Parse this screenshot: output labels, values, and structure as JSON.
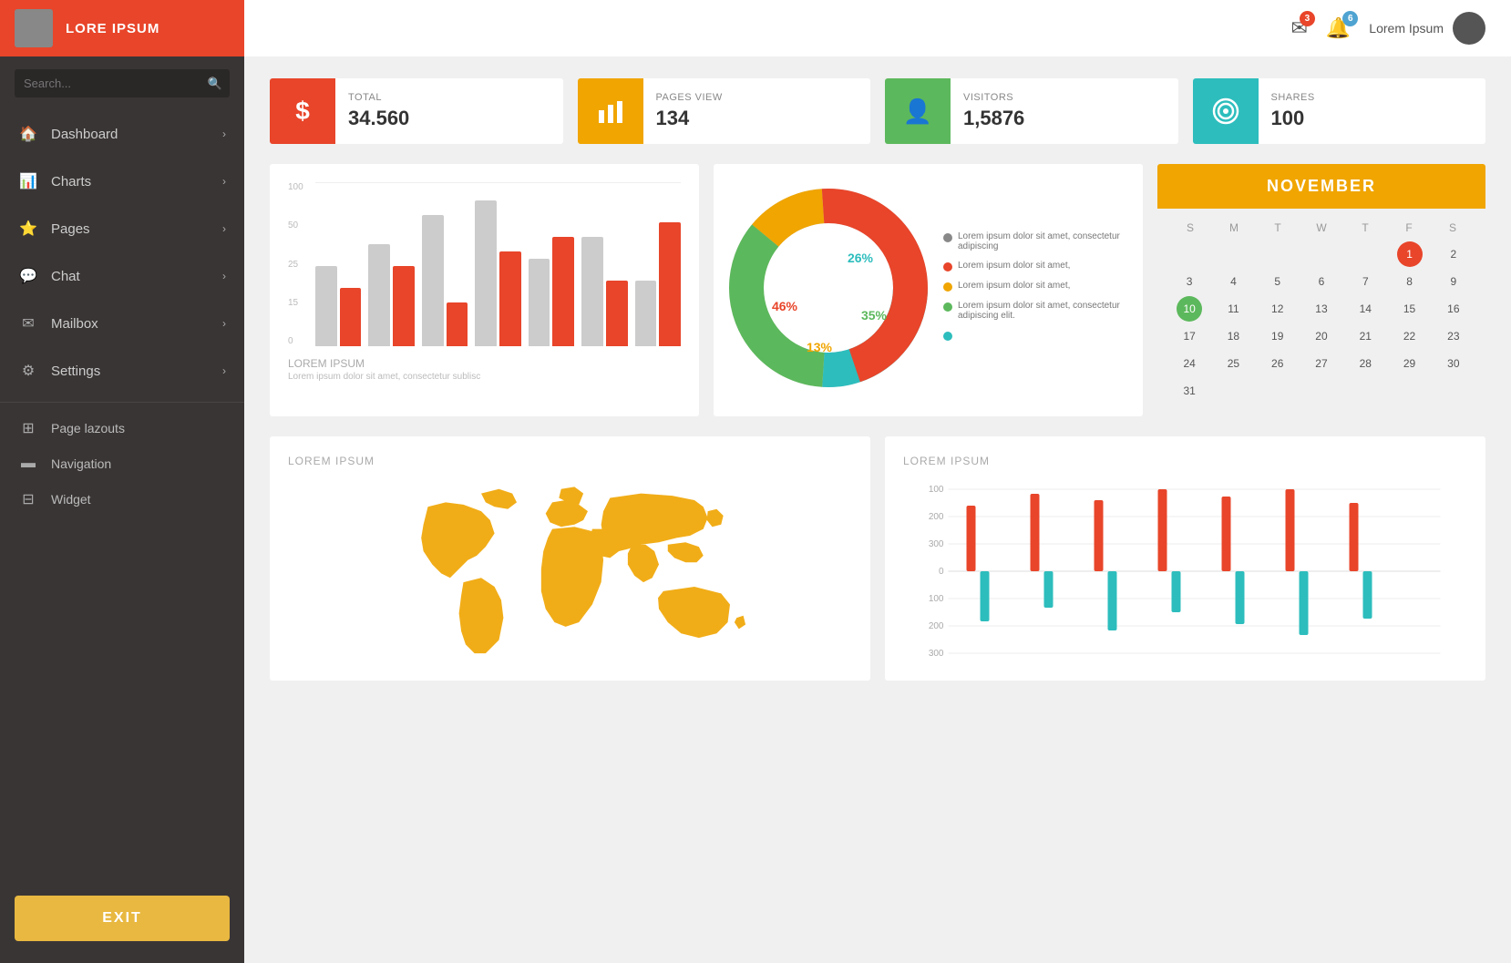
{
  "sidebar": {
    "brand": "LORE IPSUM",
    "search_placeholder": "Search...",
    "nav_items": [
      {
        "id": "dashboard",
        "label": "Dashboard",
        "icon": "🏠",
        "has_arrow": true
      },
      {
        "id": "charts",
        "label": "Charts",
        "icon": "📊",
        "has_arrow": true
      },
      {
        "id": "pages",
        "label": "Pages",
        "icon": "⭐",
        "has_arrow": true
      },
      {
        "id": "chat",
        "label": "Chat",
        "icon": "💬",
        "has_arrow": true
      },
      {
        "id": "mailbox",
        "label": "Mailbox",
        "icon": "✉",
        "has_arrow": true
      },
      {
        "id": "settings",
        "label": "Settings",
        "icon": "⚙",
        "has_arrow": true
      }
    ],
    "secondary_items": [
      {
        "id": "page-layouts",
        "label": "Page lazouts",
        "icon": "⊞"
      },
      {
        "id": "navigation",
        "label": "Navigation",
        "icon": "▬"
      },
      {
        "id": "widget",
        "label": "Widget",
        "icon": "⊟"
      }
    ],
    "exit_label": "EXIT"
  },
  "topbar": {
    "mail_badge": "3",
    "bell_badge": "6",
    "user_name": "Lorem Ipsum"
  },
  "stats": [
    {
      "id": "total",
      "label": "TOTAL",
      "value": "34.560",
      "icon": "$",
      "color": "#e8452a"
    },
    {
      "id": "pages-view",
      "label": "PAGES VIEW",
      "value": "134",
      "icon": "📊",
      "color": "#f0a500"
    },
    {
      "id": "visitors",
      "label": "VISITORS",
      "value": "1,5876",
      "icon": "👤",
      "color": "#5cb85c"
    },
    {
      "id": "shares",
      "label": "SHARES",
      "value": "100",
      "icon": "◎",
      "color": "#2dbdbd"
    }
  ],
  "bar_chart": {
    "title": "LOREM IPSUM",
    "subtitle": "Lorem ipsum dolor sit amet, consectetur sublisc",
    "y_labels": [
      "100",
      "50",
      "25",
      "15",
      "0"
    ],
    "bars": [
      {
        "gray": 55,
        "red": 40
      },
      {
        "gray": 70,
        "red": 55
      },
      {
        "gray": 90,
        "red": 30
      },
      {
        "gray": 100,
        "red": 65
      },
      {
        "gray": 60,
        "red": 75
      },
      {
        "gray": 75,
        "red": 45
      },
      {
        "gray": 45,
        "red": 85
      }
    ]
  },
  "donut_chart": {
    "segments": [
      {
        "label": "26%",
        "color": "#2dbdbd",
        "percent": 26,
        "legend": "Lorem ipsum dolor sit amet, consectetur adipiscing"
      },
      {
        "label": "35%",
        "color": "#5cb85c",
        "percent": 35,
        "legend": "Lorem ipsum dolor sit amet,"
      },
      {
        "label": "13%",
        "color": "#f0a500",
        "percent": 13,
        "legend": "Lorem ipsum dolor sit amet,"
      },
      {
        "label": "46%",
        "color": "#e8452a",
        "percent": 46,
        "legend": "Lorem ipsum dolor sit amet, consectetur adipiscing elit."
      },
      {
        "label": "",
        "color": "#ccc",
        "percent": 0,
        "legend": ""
      }
    ]
  },
  "calendar": {
    "month": "NOVEMBER",
    "weekdays": [
      "S",
      "M",
      "T",
      "W",
      "T",
      "F",
      "S"
    ],
    "weeks": [
      [
        "",
        "",
        "",
        "",
        "",
        "1",
        "2",
        "3",
        "4"
      ],
      [
        "5",
        "6",
        "7",
        "8",
        "9",
        "10",
        "11"
      ],
      [
        "12",
        "13",
        "14",
        "15",
        "16",
        "17",
        "18"
      ],
      [
        "19",
        "20",
        "21",
        "22",
        "23",
        "24",
        "25"
      ],
      [
        "26",
        "27",
        "28",
        "29",
        "30",
        "31",
        ""
      ]
    ],
    "today": "1",
    "highlighted": "10"
  },
  "world_map": {
    "title": "LOREM IPSUM"
  },
  "lollipop_chart": {
    "title": "LOREM IPSUM",
    "y_labels": [
      "100",
      "200",
      "300",
      "0",
      "100",
      "200",
      "300"
    ],
    "bars": [
      {
        "up": 60,
        "down": 40
      },
      {
        "up": 80,
        "down": 30
      },
      {
        "up": 70,
        "down": 50
      },
      {
        "up": 90,
        "down": 35
      },
      {
        "up": 75,
        "down": 45
      },
      {
        "up": 85,
        "down": 55
      },
      {
        "up": 65,
        "down": 40
      }
    ]
  }
}
